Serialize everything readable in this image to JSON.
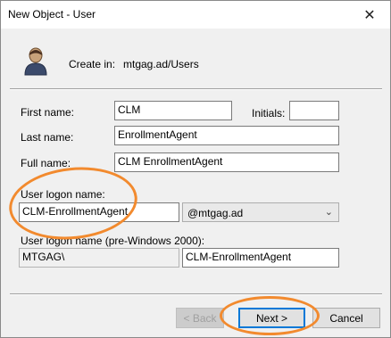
{
  "window": {
    "title": "New Object - User",
    "close_glyph": "✕"
  },
  "header": {
    "create_in_label": "Create in:",
    "create_in_value": "mtgag.ad/Users"
  },
  "form": {
    "first_name_label": "First name:",
    "first_name_value": "CLM",
    "initials_label": "Initials:",
    "initials_value": "",
    "last_name_label": "Last name:",
    "last_name_value": "EnrollmentAgent",
    "full_name_label": "Full name:",
    "full_name_value": "CLM EnrollmentAgent",
    "logon_label": "User logon name:",
    "logon_value": "CLM-EnrollmentAgent",
    "domain_value": "@mtgag.ad",
    "pre2000_label": "User logon name (pre-Windows 2000):",
    "pre2000_domain": "MTGAG\\",
    "pre2000_value": "CLM-EnrollmentAgent"
  },
  "buttons": {
    "back": "< Back",
    "next": "Next >",
    "cancel": "Cancel"
  },
  "annotation": {
    "color": "#f28a2e"
  },
  "icons": {
    "user": "user-icon",
    "close": "close-icon",
    "dropdown": "chevron-down-icon"
  }
}
